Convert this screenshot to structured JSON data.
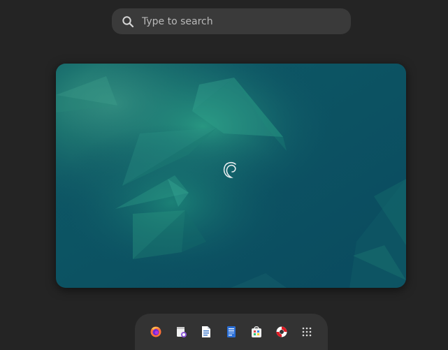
{
  "search": {
    "placeholder": "Type to search",
    "icon": "search-icon"
  },
  "workspace": {
    "wallpaper": "debian-emerald",
    "logo": "debian-swirl-icon",
    "colors": {
      "base": "#0b4f62",
      "accent": "#1d8a7a",
      "shard": "#27a08a"
    }
  },
  "dash": {
    "items": [
      {
        "name": "firefox",
        "icon": "firefox-icon"
      },
      {
        "name": "evolution",
        "icon": "mail-calendar-icon"
      },
      {
        "name": "text-editor",
        "icon": "document-icon"
      },
      {
        "name": "libreoffice-writer",
        "icon": "writer-icon"
      },
      {
        "name": "software",
        "icon": "software-store-icon"
      },
      {
        "name": "help",
        "icon": "lifebuoy-icon"
      },
      {
        "name": "show-apps",
        "icon": "app-grid-icon"
      }
    ]
  }
}
